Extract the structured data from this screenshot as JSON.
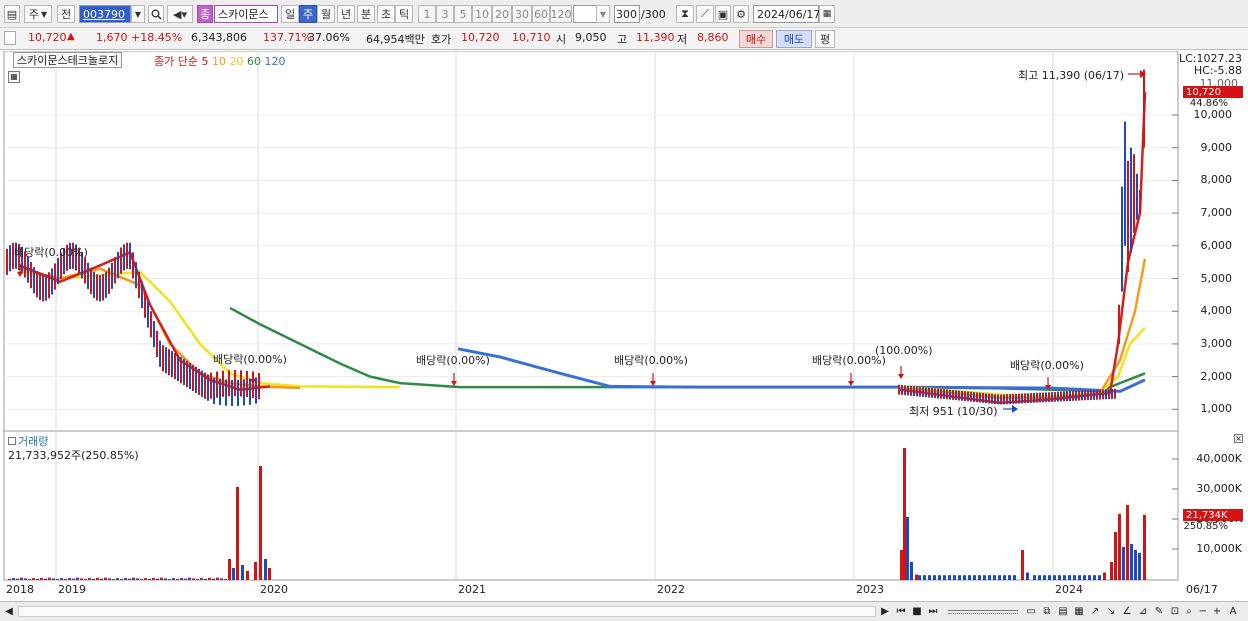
{
  "toolbar": {
    "code_value": "003790",
    "market_label": "주",
    "prev_label": "전",
    "stock_name": "스카이문스",
    "period_buttons": [
      "일",
      "주",
      "월",
      "년",
      "분",
      "초",
      "틱"
    ],
    "interval_buttons": [
      "1",
      "3",
      "5",
      "10",
      "20",
      "30",
      "60",
      "120"
    ],
    "count_value": "300",
    "count_total": "/300",
    "date_value": "2024/06/17",
    "jung_label": "종"
  },
  "quote": {
    "price": "10,720",
    "change": "1,670",
    "change_pct": "+18.45%",
    "volume": "6,343,806",
    "vol_ratio": "137.71%",
    "turnover": "37.06%",
    "amount": "64,954백만",
    "hoga_label": "호가",
    "ask": "10,720",
    "bid": "10,710",
    "open_label": "시",
    "open": "9,050",
    "high_label": "고",
    "high": "11,390",
    "low_label": "저",
    "low": "8,860",
    "buy_label": "매수",
    "sell_label": "매도",
    "eval_label": "평"
  },
  "price_panel": {
    "legend_name": "스카이문스테크놀로지",
    "legend_ma": "종가 단순",
    "ma_periods": [
      "5",
      "10",
      "20",
      "60",
      "120"
    ],
    "ma_colors": [
      "#d62020",
      "#f39a1b",
      "#f3e21b",
      "#2e8b47",
      "#3b6fd6"
    ],
    "lc_label": "LC:1027.23",
    "hc_label": "HC:-5.88",
    "top_tick": "11,000",
    "current_price_badge": "10,720",
    "current_pct_badge": "44.86%",
    "yticks": [
      "10,000",
      "9,000",
      "8,000",
      "7,000",
      "6,000",
      "5,000",
      "4,000",
      "3,000",
      "2,000",
      "1,000"
    ],
    "high_annotation": "최고 11,390 (06/17)",
    "low_annotation": "최저 951 (10/30)",
    "dividend_notes": [
      "배당락(0.00%)",
      "배당락(0.00%)",
      "배당락(0.00%)",
      "배당락(0.00%)",
      "배당락(0.00%)",
      "(100.00%)",
      "배당락(0.00%)"
    ]
  },
  "volume_panel": {
    "title": "거래량",
    "value_text": "21,733,952주(250.85%)",
    "yticks": [
      "40,000K",
      "30,000K",
      "20,000K",
      "10,000K"
    ],
    "current_badge": "21,734K",
    "current_pct": "250.85%"
  },
  "x_axis": {
    "labels": [
      "2018",
      "2019",
      "2020",
      "2021",
      "2022",
      "2023",
      "2024"
    ],
    "end_label": "06/17"
  }
}
